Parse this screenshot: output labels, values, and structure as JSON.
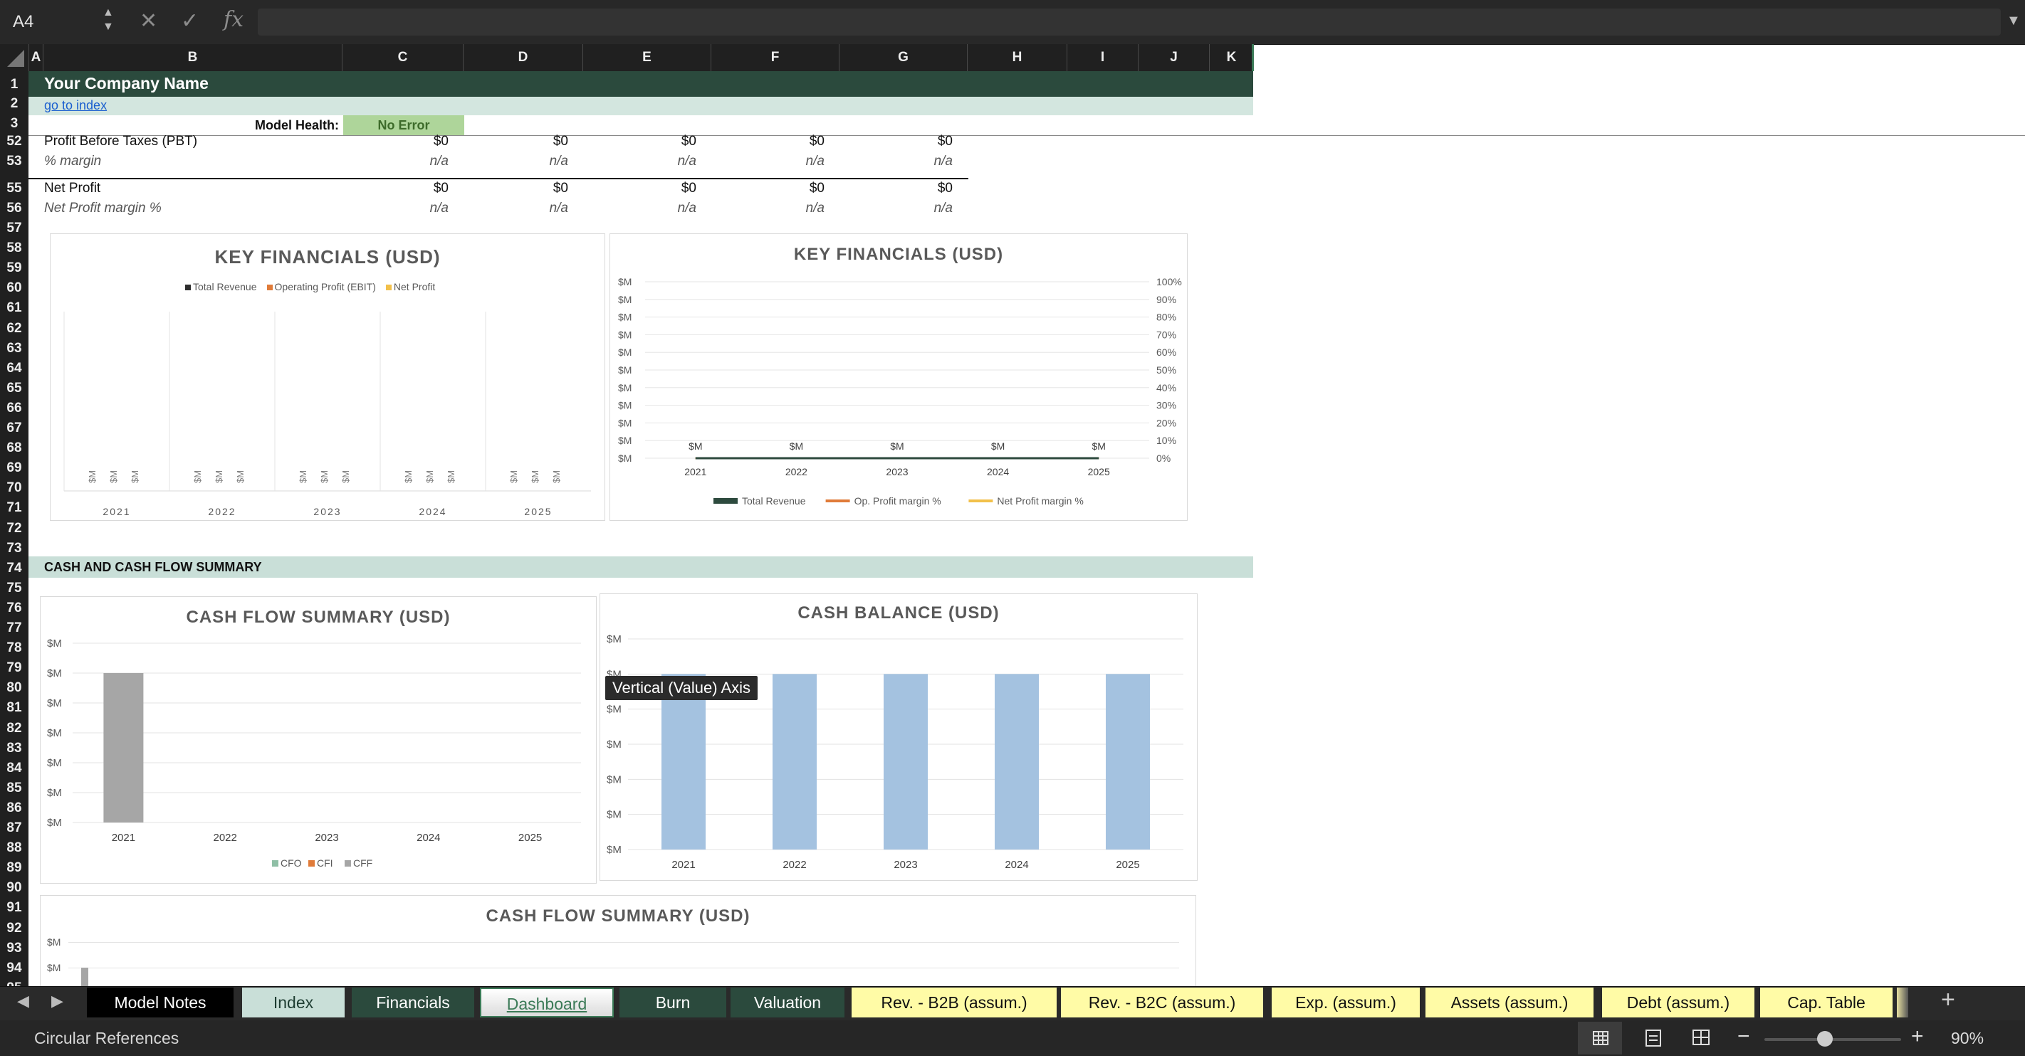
{
  "formula_bar": {
    "cell_ref": "A4",
    "cancel_icon": "✕",
    "confirm_icon": "✓",
    "fx_label": "fx",
    "formula": ""
  },
  "columns": [
    "A",
    "B",
    "C",
    "D",
    "E",
    "F",
    "G",
    "H",
    "I",
    "J",
    "K"
  ],
  "rows": [
    "1",
    "2",
    "3",
    "52",
    "53",
    "55",
    "56",
    "57",
    "58",
    "59",
    "60",
    "61",
    "62",
    "63",
    "64",
    "65",
    "66",
    "67",
    "68",
    "69",
    "70",
    "71",
    "72",
    "73",
    "74",
    "75",
    "76",
    "77",
    "78",
    "79",
    "80",
    "81",
    "82",
    "83",
    "84",
    "85",
    "86",
    "87",
    "88",
    "89",
    "90",
    "91",
    "92",
    "93",
    "94",
    "95"
  ],
  "sheet": {
    "company_name": "Your Company Name",
    "index_link": "go to index",
    "model_health_label": "Model Health:",
    "model_health_value": "No Error",
    "pbt_label": "Profit Before Taxes (PBT)",
    "pbt_values": [
      "$0",
      "$0",
      "$0",
      "$0",
      "$0"
    ],
    "margin_label": "% margin",
    "margin_values": [
      "n/a",
      "n/a",
      "n/a",
      "n/a",
      "n/a"
    ],
    "net_profit_label": "Net Profit",
    "net_profit_values": [
      "$0",
      "$0",
      "$0",
      "$0",
      "$0"
    ],
    "net_margin_label": "Net Profit margin %",
    "net_margin_values": [
      "n/a",
      "n/a",
      "n/a",
      "n/a",
      "n/a"
    ],
    "section_cash": "CASH AND CASH FLOW SUMMARY"
  },
  "tooltip": "Vertical (Value) Axis",
  "chart_data": [
    {
      "type": "bar",
      "title": "KEY FINANCIALS (USD)",
      "categories": [
        "2021",
        "2022",
        "2023",
        "2024",
        "2025"
      ],
      "series": [
        {
          "name": "Total Revenue",
          "values": [
            0,
            0,
            0,
            0,
            0
          ],
          "color": "#2d2d2d"
        },
        {
          "name": "Operating Profit (EBIT)",
          "values": [
            0,
            0,
            0,
            0,
            0
          ],
          "color": "#e07b39"
        },
        {
          "name": "Net Profit",
          "values": [
            0,
            0,
            0,
            0,
            0
          ],
          "color": "#f2c04a"
        }
      ],
      "data_label": "$M",
      "legend": "top"
    },
    {
      "type": "line",
      "title": "KEY FINANCIALS (USD)",
      "categories": [
        "2021",
        "2022",
        "2023",
        "2024",
        "2025"
      ],
      "y_ticks": [
        "$M",
        "$M",
        "$M",
        "$M",
        "$M",
        "$M",
        "$M",
        "$M",
        "$M",
        "$M",
        "$M"
      ],
      "y2_ticks": [
        "100%",
        "90%",
        "80%",
        "70%",
        "60%",
        "50%",
        "40%",
        "30%",
        "20%",
        "10%",
        "0%"
      ],
      "series": [
        {
          "name": "Total Revenue",
          "values": [
            0,
            0,
            0,
            0,
            0
          ],
          "color": "#2d4a3e"
        },
        {
          "name": "Op. Profit margin %",
          "values": [
            0,
            0,
            0,
            0,
            0
          ],
          "color": "#e07b39"
        },
        {
          "name": "Net Profit margin %",
          "values": [
            0,
            0,
            0,
            0,
            0
          ],
          "color": "#f2c04a"
        }
      ],
      "data_label": "$M",
      "legend": "bottom"
    },
    {
      "type": "bar",
      "title": "CASH FLOW SUMMARY (USD)",
      "categories": [
        "2021",
        "2022",
        "2023",
        "2024",
        "2025"
      ],
      "y_ticks": [
        "$M",
        "$M",
        "$M",
        "$M",
        "$M",
        "$M",
        "$M"
      ],
      "series": [
        {
          "name": "CFO",
          "values": [
            0,
            0,
            0,
            0,
            0
          ],
          "color": "#8fbfa6"
        },
        {
          "name": "CFI",
          "values": [
            0,
            0,
            0,
            0,
            0
          ],
          "color": "#e07b39"
        },
        {
          "name": "CFF",
          "values": [
            5,
            0,
            0,
            0,
            0
          ],
          "color": "#a6a6a6"
        }
      ],
      "ylim": [
        0,
        6
      ],
      "legend": "bottom"
    },
    {
      "type": "bar",
      "title": "CASH BALANCE (USD)",
      "categories": [
        "2021",
        "2022",
        "2023",
        "2024",
        "2025"
      ],
      "y_ticks": [
        "$M",
        "$M",
        "$M",
        "$M",
        "$M",
        "$M",
        "$M"
      ],
      "series": [
        {
          "name": "Cash Balance",
          "values": [
            5,
            5,
            5,
            5,
            5
          ],
          "color": "#a4c2e0"
        }
      ],
      "ylim": [
        0,
        6
      ]
    },
    {
      "type": "bar",
      "title": "CASH FLOW SUMMARY (USD)",
      "y_ticks": [
        "$M",
        "$M"
      ]
    }
  ],
  "tabs": [
    {
      "label": "Model Notes",
      "bg": "#000000",
      "fg": "#ffffff"
    },
    {
      "label": "Index",
      "bg": "#c9dfd8",
      "fg": "#1e3d32"
    },
    {
      "label": "Financials",
      "bg": "#2b4a3d",
      "fg": "#ffffff"
    },
    {
      "label": "Dashboard",
      "bg": "#f5f5f5",
      "fg": "#3b7a57"
    },
    {
      "label": "Burn",
      "bg": "#2b4a3d",
      "fg": "#ffffff"
    },
    {
      "label": "Valuation",
      "bg": "#2b4a3d",
      "fg": "#ffffff"
    },
    {
      "label": "Rev. - B2B (assum.)",
      "bg": "#fffba6",
      "fg": "#111111"
    },
    {
      "label": "Rev. - B2C (assum.)",
      "bg": "#fffba6",
      "fg": "#111111"
    },
    {
      "label": "Exp. (assum.)",
      "bg": "#fffba6",
      "fg": "#111111"
    },
    {
      "label": "Assets (assum.)",
      "bg": "#fffba6",
      "fg": "#111111"
    },
    {
      "label": "Debt (assum.)",
      "bg": "#fffba6",
      "fg": "#111111"
    },
    {
      "label": "Cap. Table",
      "bg": "#fffba6",
      "fg": "#111111"
    }
  ],
  "status": {
    "circular": "Circular References",
    "zoom": "90%"
  }
}
